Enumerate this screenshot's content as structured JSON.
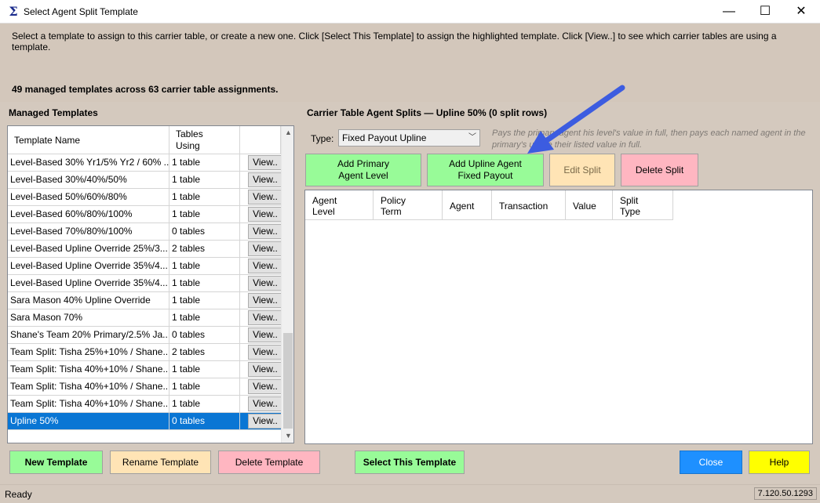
{
  "window": {
    "title": "Select Agent Split Template",
    "minimize_glyph": "—",
    "maximize_glyph": "☐",
    "close_glyph": "✕"
  },
  "header": {
    "instruction": "Select a template to assign to this carrier table, or create a new one. Click [Select This Template] to assign the highlighted template. Click [View..] to see which carrier tables are using a template.",
    "count_text": "49 managed templates across 63 carrier table assignments."
  },
  "managed_templates": {
    "label": "Managed Templates",
    "columns": {
      "name": "Template Name",
      "tables": "Tables\nUsing"
    },
    "view_label": "View..",
    "rows": [
      {
        "name": "Level-Based 30% Yr1/5% Yr2 / 60% ...",
        "tables": "1 table"
      },
      {
        "name": "Level-Based 30%/40%/50%",
        "tables": "1 table"
      },
      {
        "name": "Level-Based 50%/60%/80%",
        "tables": "1 table"
      },
      {
        "name": "Level-Based 60%/80%/100%",
        "tables": "1 table"
      },
      {
        "name": "Level-Based 70%/80%/100%",
        "tables": "0 tables"
      },
      {
        "name": "Level-Based Upline Override 25%/3...",
        "tables": "2 tables"
      },
      {
        "name": "Level-Based Upline Override 35%/4...",
        "tables": "1 table"
      },
      {
        "name": "Level-Based Upline Override 35%/4...",
        "tables": "1 table"
      },
      {
        "name": "Sara Mason 40% Upline Override",
        "tables": "1 table"
      },
      {
        "name": "Sara Mason 70%",
        "tables": "1 table"
      },
      {
        "name": "Shane's Team 20% Primary/2.5% Ja...",
        "tables": "0 tables"
      },
      {
        "name": "Team Split: Tisha 25%+10% / Shane...",
        "tables": "2 tables"
      },
      {
        "name": "Team Split: Tisha 40%+10% / Shane...",
        "tables": "1 table"
      },
      {
        "name": "Team Split: Tisha 40%+10% / Shane...",
        "tables": "1 table"
      },
      {
        "name": "Team Split: Tisha 40%+10% / Shane...",
        "tables": "1 table"
      },
      {
        "name": "Upline 50%",
        "tables": "0 tables",
        "selected": true
      }
    ]
  },
  "splits": {
    "label": "Carrier Table Agent Splits — Upline 50%  (0 split rows)",
    "type_label": "Type:",
    "type_value": "Fixed Payout Upline",
    "hint": "Pays the primary agent his level's value in full, then pays each named agent in the primary's upline their listed value in full.",
    "buttons": {
      "add_primary": "Add Primary\nAgent Level",
      "add_upline": "Add Upline Agent\nFixed Payout",
      "edit": "Edit Split",
      "delete": "Delete Split"
    },
    "columns": [
      "Agent\nLevel",
      "Policy\nTerm",
      "Agent",
      "Transaction",
      "Value",
      "Split\nType"
    ]
  },
  "footer_buttons": {
    "new": "New Template",
    "rename": "Rename Template",
    "delete": "Delete Template",
    "select": "Select This Template",
    "close": "Close",
    "help": "Help"
  },
  "status": {
    "text": "Ready",
    "version": "7.120.50.1293"
  },
  "colors": {
    "green_button": "#98fb98",
    "peach_button": "#ffe4b5",
    "pink_button": "#ffb6c1",
    "blue_button": "#1e90ff",
    "yellow_button": "#ffff00",
    "selection": "#0a76d4",
    "annotation_arrow": "#3c5ce0"
  }
}
